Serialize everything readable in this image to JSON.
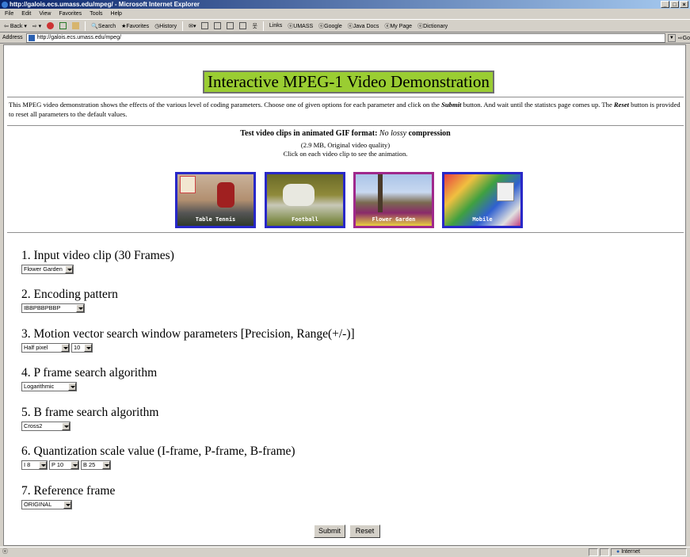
{
  "window": {
    "title": "http://galois.ecs.umass.edu/mpeg/ - Microsoft Internet Explorer",
    "controls": [
      "_",
      "□",
      "×"
    ]
  },
  "menu": [
    "File",
    "Edit",
    "View",
    "Favorites",
    "Tools",
    "Help"
  ],
  "toolbar": {
    "back": "Back",
    "search": "Search",
    "favorites": "Favorites",
    "history": "History",
    "links": "Links",
    "link_items": [
      "UMASS",
      "Google",
      "Java Docs",
      "My Page",
      "Dictionary"
    ]
  },
  "address": {
    "label": "Address",
    "url": "http://galois.ecs.umass.edu/mpeg/",
    "go": "Go"
  },
  "page": {
    "title": "Interactive MPEG-1 Video Demonstration",
    "intro_1": "This MPEG video demonstration shows the effects of the various level of coding parameters. Choose one of given options for each parameter and click on the ",
    "intro_submit": "Submit",
    "intro_2": " button. And wait until the statistcs page comes up. The ",
    "intro_reset": "Reset",
    "intro_3": " button is provided to reset all parameters to the default values.",
    "clips_heading_a": "Test video clips in animated GIF format: ",
    "clips_heading_em": "No lossy",
    "clips_heading_b": " compression",
    "clips_size": "(2.9 MB, Original video quality)",
    "clips_hint": "Click on each video clip to see the animation.",
    "clips": [
      {
        "label": "Table Tennis",
        "border": "#2828c8"
      },
      {
        "label": "Football",
        "border": "#2828c8"
      },
      {
        "label": "Flower Garden",
        "border": "#a0288c"
      },
      {
        "label": "Mobile",
        "border": "#2828c8"
      }
    ]
  },
  "params": [
    {
      "num": "1.",
      "title": "Input video clip (30 Frames)",
      "selects": [
        "Flower Garden"
      ]
    },
    {
      "num": "2.",
      "title": "Encoding pattern",
      "selects": [
        "IBBPBBPBBP"
      ]
    },
    {
      "num": "3.",
      "title": "Motion vector search window parameters [Precision, Range(+/-)]",
      "selects": [
        "Half pixel",
        "10"
      ]
    },
    {
      "num": "4.",
      "title": "P frame search algorithm",
      "selects": [
        "Logarithmic"
      ]
    },
    {
      "num": "5.",
      "title": "B frame search algorithm",
      "selects": [
        "Cross2"
      ]
    },
    {
      "num": "6.",
      "title": "Quantization scale value (I-frame, P-frame, B-frame)",
      "selects": [
        "I 8",
        "P 10",
        "B 25"
      ]
    },
    {
      "num": "7.",
      "title": "Reference frame",
      "selects": [
        "ORIGINAL"
      ]
    }
  ],
  "buttons": {
    "submit": "Submit",
    "reset": "Reset"
  },
  "status": {
    "zone": "Internet"
  }
}
